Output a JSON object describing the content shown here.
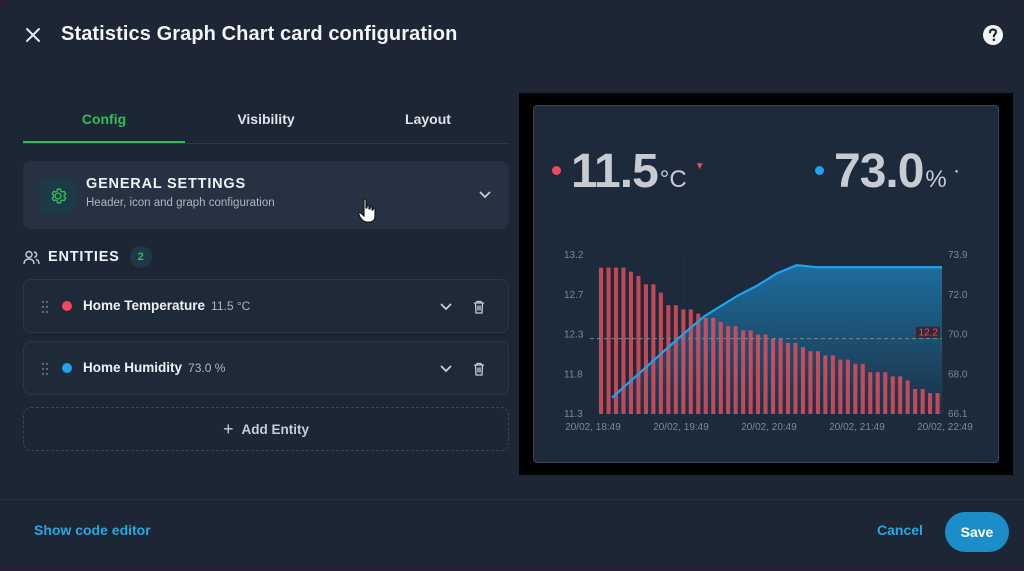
{
  "dialog": {
    "title": "Statistics Graph Chart card configuration",
    "close_icon": "close-icon",
    "help_icon": "help-circle-icon"
  },
  "tabs": [
    {
      "label": "Config",
      "active": true
    },
    {
      "label": "Visibility",
      "active": false
    },
    {
      "label": "Layout",
      "active": false
    }
  ],
  "general_settings": {
    "title": "GENERAL SETTINGS",
    "subtitle": "Header, icon and graph configuration",
    "icon": "gear-icon"
  },
  "entities": {
    "title": "ENTITIES",
    "count": "2",
    "items": [
      {
        "name": "Home Temperature",
        "value": "11.5 °C",
        "color": "#f0495c"
      },
      {
        "name": "Home Humidity",
        "value": "73.0 %",
        "color": "#1ca4ee"
      }
    ],
    "add_label": "Add Entity"
  },
  "preview": {
    "temperature": {
      "value": "11.5",
      "unit": "°C",
      "color": "#f0495c",
      "trend": "down"
    },
    "humidity": {
      "value": "73.0",
      "unit": "%",
      "color": "#1ca4ee"
    }
  },
  "chart_data": {
    "type": "bar",
    "x_tick_labels": [
      "20/02, 18:49",
      "20/02, 19:49",
      "20/02, 20:49",
      "20/02, 21:49",
      "20/02, 22:49"
    ],
    "y_left_ticks": [
      "13.2",
      "12.7",
      "12.3",
      "11.8",
      "11.3"
    ],
    "y_left_range": [
      11.3,
      13.2
    ],
    "y_right_ticks": [
      "73.9",
      "72.0",
      "70.0",
      "68.0",
      "66.1"
    ],
    "y_right_range": [
      66.1,
      73.9
    ],
    "threshold_label": "12.2",
    "threshold_value": 12.2,
    "series": [
      {
        "name": "Home Temperature",
        "kind": "bar",
        "color": "#e04e5c",
        "values": [
          13.05,
          13.05,
          13.05,
          13.05,
          13.0,
          12.95,
          12.85,
          12.85,
          12.75,
          12.6,
          12.6,
          12.55,
          12.55,
          12.5,
          12.45,
          12.45,
          12.4,
          12.35,
          12.35,
          12.3,
          12.3,
          12.25,
          12.25,
          12.2,
          12.2,
          12.15,
          12.15,
          12.1,
          12.05,
          12.05,
          12.0,
          12.0,
          11.95,
          11.95,
          11.9,
          11.9,
          11.8,
          11.8,
          11.8,
          11.75,
          11.75,
          11.7,
          11.6,
          11.6,
          11.55,
          11.55
        ]
      },
      {
        "name": "Home Humidity",
        "kind": "area",
        "color": "#1ca4ee",
        "points": [
          [
            0,
            66.9
          ],
          [
            0.2,
            69.8
          ],
          [
            0.28,
            70.9
          ],
          [
            0.38,
            71.9
          ],
          [
            0.44,
            72.4
          ],
          [
            0.5,
            73.0
          ],
          [
            0.56,
            73.4
          ],
          [
            0.62,
            73.3
          ],
          [
            0.7,
            73.3
          ],
          [
            0.8,
            73.3
          ],
          [
            0.9,
            73.3
          ],
          [
            1.0,
            73.3
          ]
        ]
      }
    ]
  },
  "footer": {
    "code_editor_label": "Show code editor",
    "cancel_label": "Cancel",
    "save_label": "Save"
  }
}
